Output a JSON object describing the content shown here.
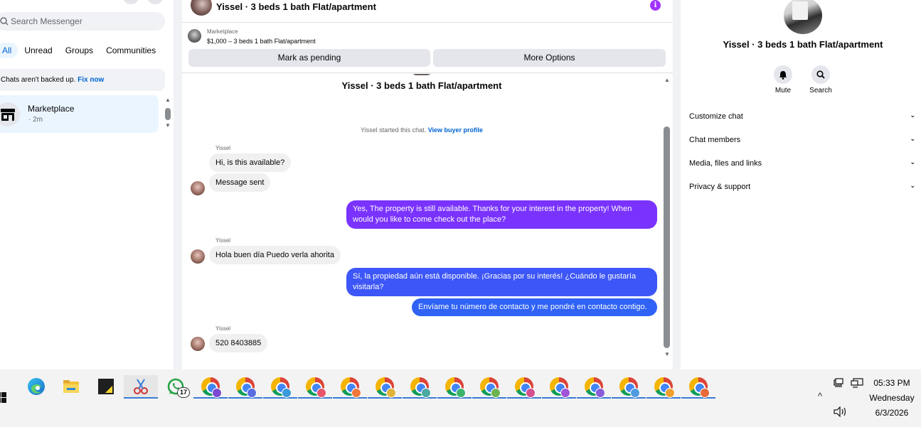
{
  "left": {
    "search_placeholder": "Search Messenger",
    "filters": [
      "All",
      "Unread",
      "Groups",
      "Communities"
    ],
    "backup_text": "Chats aren't backed up.",
    "backup_link": "Fix now",
    "conversation": {
      "name": "Marketplace",
      "time": "· 2m"
    }
  },
  "chat": {
    "header_title": "Yissel · 3 beds 1 bath Flat/apartment",
    "marketplace_label": "Marketplace",
    "listing_price": "$1,000 – 3 beds 1 bath Flat/apartment",
    "mark_pending_label": "Mark as pending",
    "more_options_label": "More Options",
    "conversation_title": "Yissel · 3 beds 1 bath Flat/apartment",
    "started_text": "Yissel started this chat.",
    "view_profile_link": "View buyer profile",
    "sender_name": "Yissel",
    "messages": [
      {
        "dir": "in",
        "text": "Hi, is this available?"
      },
      {
        "dir": "in",
        "text": "Message sent"
      },
      {
        "dir": "out",
        "text": "Yes, The property is still available. Thanks for your interest in the property! When would you like to come check out the place?"
      },
      {
        "dir": "in",
        "text": "Hola buen día Puedo verla  ahorita"
      },
      {
        "dir": "out",
        "text": "Sí, la propiedad aún está disponible. ¡Gracias por su interés! ¿Cuándo le gustaría visitarla?"
      },
      {
        "dir": "out",
        "text": "Envíame tu número de contacto y me pondré en contacto contigo."
      },
      {
        "dir": "in",
        "text": "520 8403885"
      }
    ]
  },
  "right": {
    "title": "Yissel · 3 beds 1 bath Flat/apartment",
    "mute_label": "Mute",
    "search_label": "Search",
    "sections": [
      "Customize chat",
      "Chat members",
      "Media, files and links",
      "Privacy & support"
    ]
  },
  "taskbar": {
    "whatsapp_badge": "17",
    "time": "05:33 PM",
    "day": "Wednesday",
    "date": "6/3/2026"
  },
  "colors": {
    "accent": "#0064d1",
    "outgoing_purple": "#7a33ff",
    "outgoing_blue": "#2f62f5",
    "info_icon": "#a033ff"
  }
}
